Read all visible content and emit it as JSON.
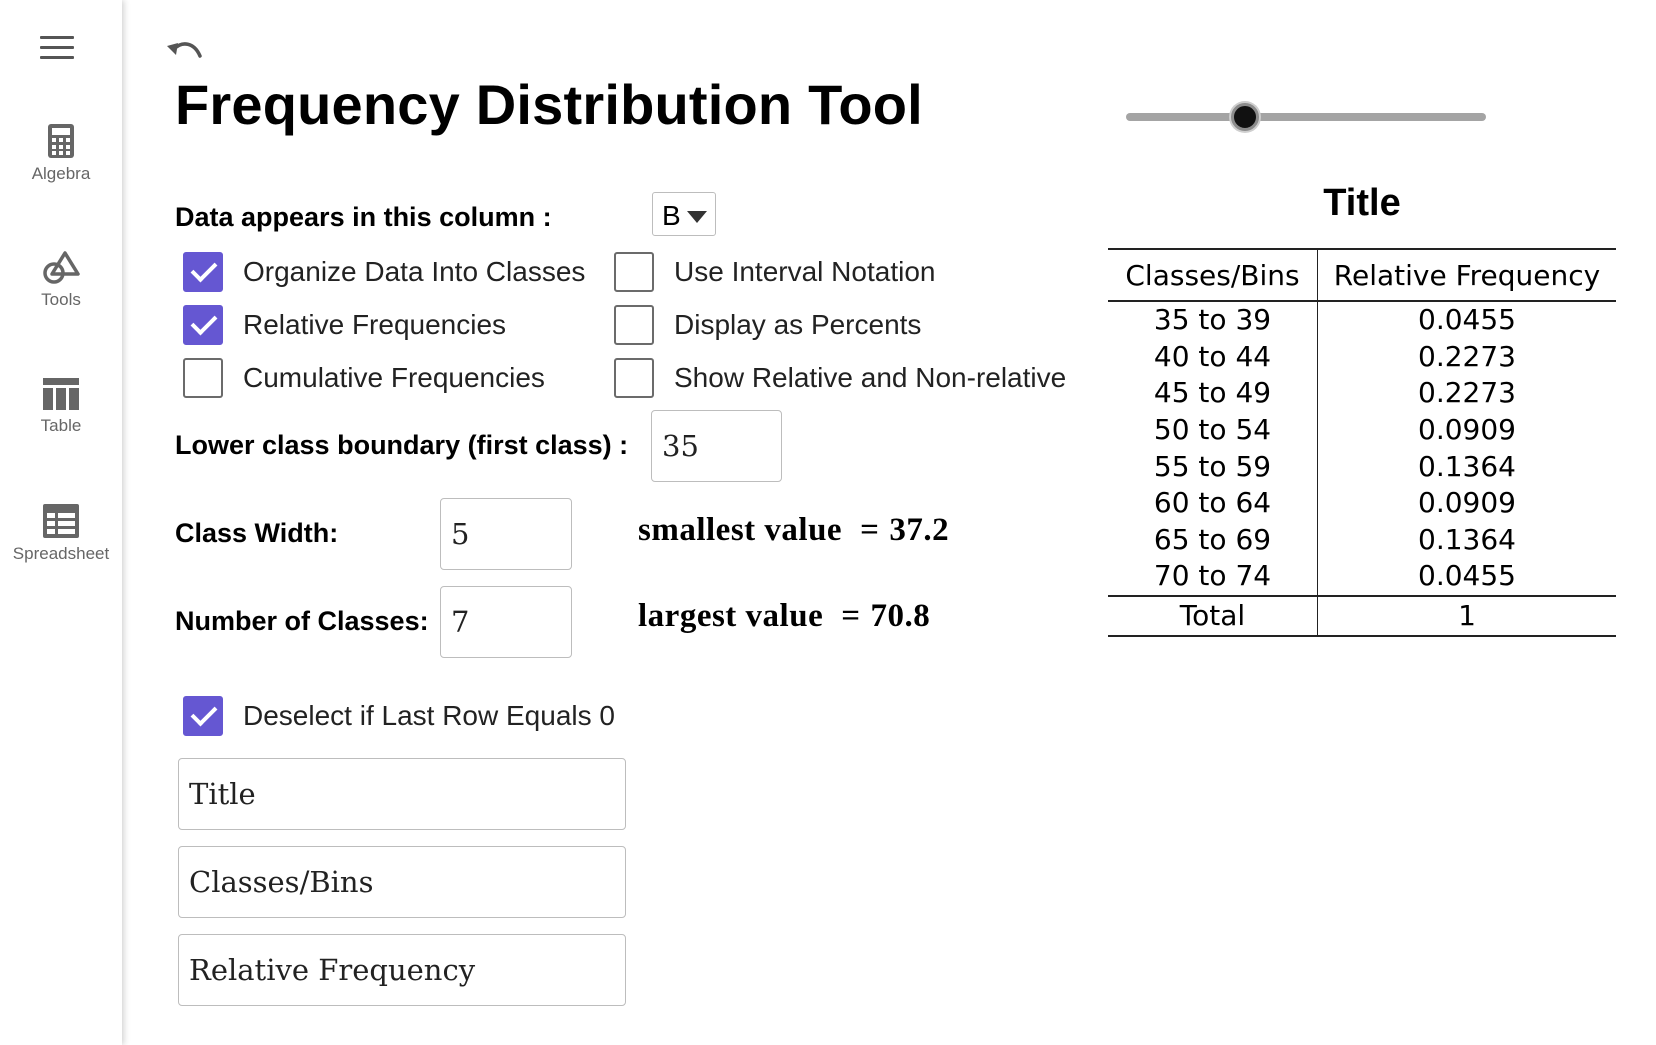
{
  "sidebar": {
    "items": [
      {
        "label": "Algebra",
        "icon": "calculator-icon"
      },
      {
        "label": "Tools",
        "icon": "shapes-icon"
      },
      {
        "label": "Table",
        "icon": "table-icon"
      },
      {
        "label": "Spreadsheet",
        "icon": "spreadsheet-icon"
      }
    ]
  },
  "header": {
    "title": "Frequency Distribution Tool"
  },
  "slider": {
    "value_fraction": 0.34
  },
  "form": {
    "data_column_label": "Data appears in this column :",
    "data_column_value": "B",
    "checkboxes": [
      {
        "label": "Organize Data Into Classes",
        "checked": true
      },
      {
        "label": "Relative Frequencies",
        "checked": true
      },
      {
        "label": "Cumulative Frequencies",
        "checked": false
      },
      {
        "label": "Use Interval Notation",
        "checked": false
      },
      {
        "label": "Display as Percents",
        "checked": false
      },
      {
        "label": "Show Relative and Non-relative",
        "checked": false
      }
    ],
    "lower_boundary_label": "Lower class boundary (first class) :",
    "lower_boundary_value": "35",
    "class_width_label": "Class Width:",
    "class_width_value": "5",
    "num_classes_label": "Number of Classes:",
    "num_classes_value": "7",
    "smallest_label": "smallest value",
    "smallest_value": "37.2",
    "largest_label": "largest value",
    "largest_value": "70.8",
    "eq_symbol": "=",
    "deselect_label": "Deselect if Last Row Equals 0",
    "deselect_checked": true,
    "title_field": "Title",
    "col1_field": "Classes/Bins",
    "col2_field": "Relative Frequency"
  },
  "table": {
    "title": "Title",
    "headers": [
      "Classes/Bins",
      "Relative Frequency"
    ],
    "rows": [
      [
        "35 to 39",
        "0.0455"
      ],
      [
        "40 to 44",
        "0.2273"
      ],
      [
        "45 to 49",
        "0.2273"
      ],
      [
        "50 to 54",
        "0.0909"
      ],
      [
        "55 to 59",
        "0.1364"
      ],
      [
        "60 to 64",
        "0.0909"
      ],
      [
        "65 to 69",
        "0.1364"
      ],
      [
        "70 to 74",
        "0.0455"
      ]
    ],
    "total_label": "Total",
    "total_value": "1"
  },
  "colors": {
    "accent": "#6557d2",
    "sidebar_text": "#666666"
  }
}
